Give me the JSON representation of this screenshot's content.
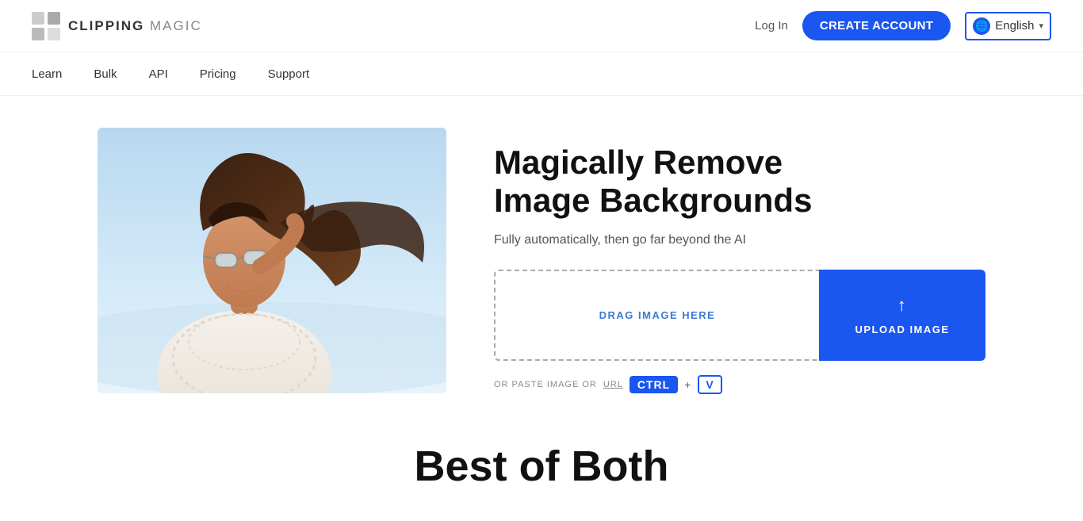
{
  "header": {
    "logo_text_bold": "CLIPPING",
    "logo_text_light": " MAGIC",
    "login_label": "Log In",
    "create_account_label": "CREATE ACCOUNT",
    "lang_label": "English",
    "lang_chevron": "▾"
  },
  "nav": {
    "items": [
      {
        "label": "Learn",
        "id": "learn"
      },
      {
        "label": "Bulk",
        "id": "bulk"
      },
      {
        "label": "API",
        "id": "api"
      },
      {
        "label": "Pricing",
        "id": "pricing"
      },
      {
        "label": "Support",
        "id": "support"
      }
    ]
  },
  "hero": {
    "title_line1": "Magically Remove",
    "title_line2": "Image Backgrounds",
    "subtitle": "Fully automatically, then go far beyond the AI",
    "drag_label": "DRAG IMAGE HERE",
    "upload_label": "UPLOAD IMAGE",
    "paste_prefix": "OR PASTE IMAGE OR",
    "url_label": "URL",
    "ctrl_label": "CTRL",
    "plus_label": "+",
    "v_label": "V"
  },
  "bottom": {
    "section_title": "Best of Both"
  },
  "icons": {
    "globe": "🌐",
    "upload_arrow": "↑"
  }
}
